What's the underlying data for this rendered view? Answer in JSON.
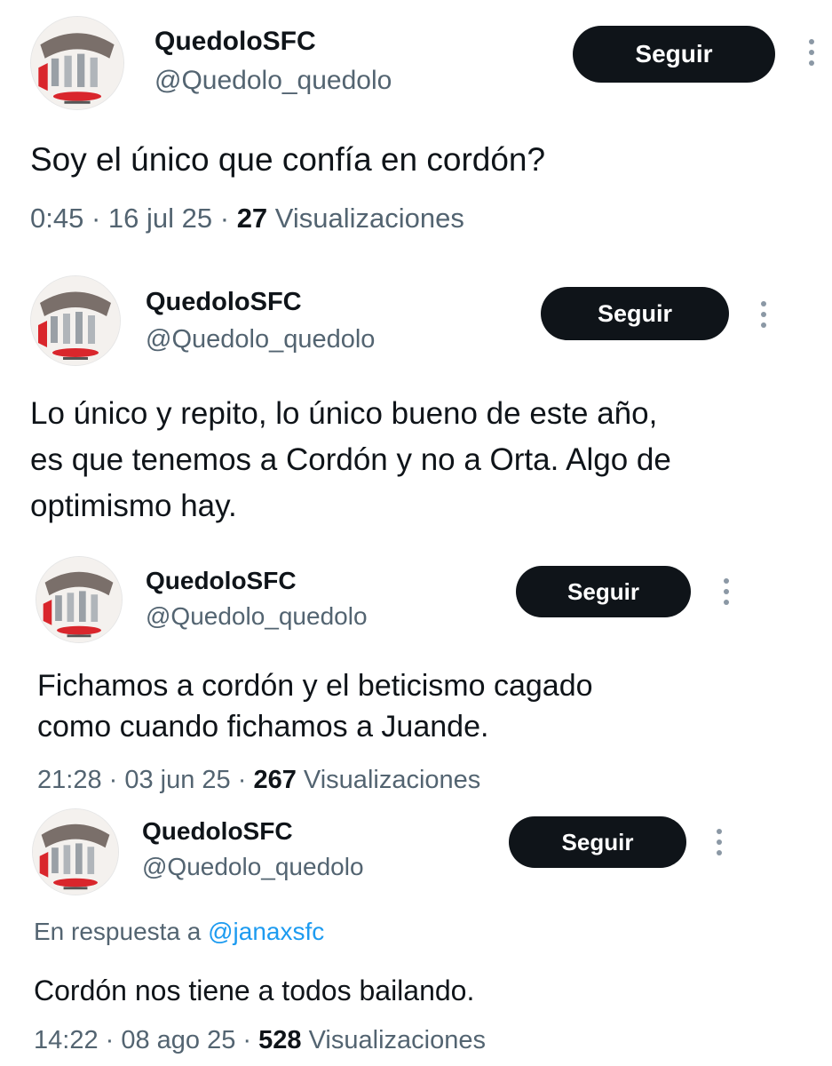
{
  "tweets": [
    {
      "name": "QuedoloSFC",
      "handle": "@Quedolo_quedolo",
      "follow_label": "Seguir",
      "text": "Soy el único que confía en cordón?",
      "time": "0:45",
      "date": "16 jul 25",
      "views": "27",
      "views_label": "Visualizaciones"
    },
    {
      "name": "QuedoloSFC",
      "handle": "@Quedolo_quedolo",
      "follow_label": "Seguir",
      "text_lines": [
        "Lo único y repito, lo único bueno de este año,",
        "es que tenemos a Cordón y no a Orta. Algo de",
        "optimismo hay."
      ]
    },
    {
      "name": "QuedoloSFC",
      "handle": "@Quedolo_quedolo",
      "follow_label": "Seguir",
      "text_lines": [
        "Fichamos a cordón y el beticismo cagado",
        "como cuando fichamos a Juande."
      ],
      "time": "21:28",
      "date": "03 jun 25",
      "views": "267",
      "views_label": "Visualizaciones"
    },
    {
      "name": "QuedoloSFC",
      "handle": "@Quedolo_quedolo",
      "follow_label": "Seguir",
      "reply_prefix": "En respuesta a",
      "reply_to": "@janaxsfc",
      "text": "Cordón nos tiene a todos bailando.",
      "time": "14:22",
      "date": "08 ago 25",
      "views": "528",
      "views_label": "Visualizaciones"
    }
  ],
  "separator": " · ",
  "icons": {
    "avatar": "club-badge-avatar-icon",
    "more": "more-vertical-icon"
  }
}
